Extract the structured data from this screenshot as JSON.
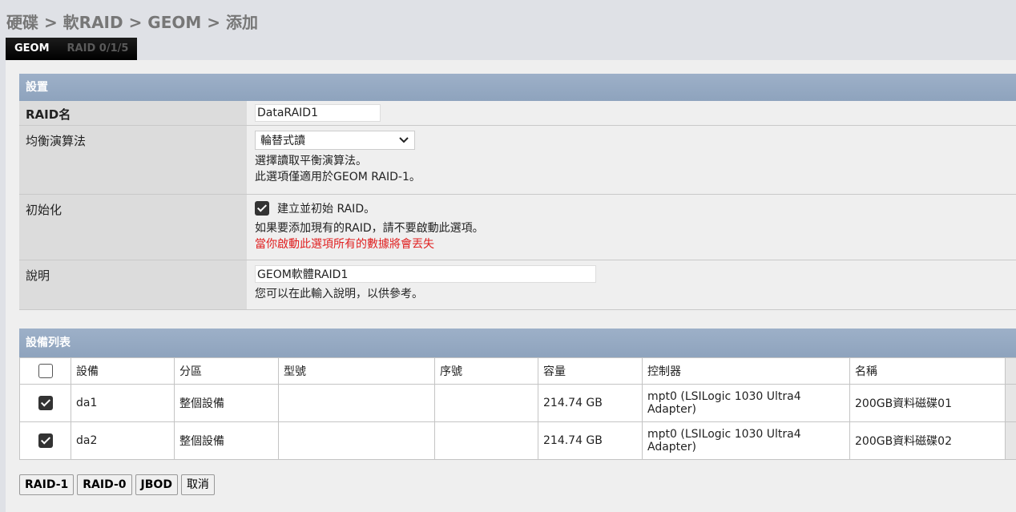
{
  "breadcrumb": "硬碟 > 軟RAID > GEOM > 添加",
  "tabs": [
    {
      "label": "GEOM",
      "active": true
    },
    {
      "label": "RAID 0/1/5",
      "active": false
    }
  ],
  "settings": {
    "header": "設置",
    "raid_name": {
      "label": "RAID名",
      "value": "DataRAID1"
    },
    "balance": {
      "label": "均衡演算法",
      "selected": "輪替式讀",
      "hint1": "選擇讀取平衡演算法。",
      "hint2": "此選項僅適用於GEOM RAID-1。"
    },
    "init": {
      "label": "初始化",
      "checkbox_label": "建立並初始 RAID。",
      "checked": true,
      "hint": "如果要添加現有的RAID，請不要啟動此選項。",
      "warning": "當你啟動此選項所有的數據將會丟失"
    },
    "description": {
      "label": "說明",
      "value": "GEOM軟體RAID1",
      "hint": "您可以在此輸入說明，以供參考。"
    }
  },
  "devices": {
    "header": "設備列表",
    "columns": [
      "設備",
      "分區",
      "型號",
      "序號",
      "容量",
      "控制器",
      "名稱"
    ],
    "rows": [
      {
        "checked": true,
        "device": "da1",
        "partition": "整個設備",
        "model": "",
        "serial": "",
        "size": "214.74 GB",
        "controller": "mpt0 (LSILogic 1030 Ultra4 Adapter)",
        "name": "200GB資料磁碟01"
      },
      {
        "checked": true,
        "device": "da2",
        "partition": "整個設備",
        "model": "",
        "serial": "",
        "size": "214.74 GB",
        "controller": "mpt0 (LSILogic 1030 Ultra4 Adapter)",
        "name": "200GB資料磁碟02"
      }
    ]
  },
  "buttons": {
    "raid1": "RAID-1",
    "raid0": "RAID-0",
    "jbod": "JBOD",
    "cancel": "取消"
  }
}
